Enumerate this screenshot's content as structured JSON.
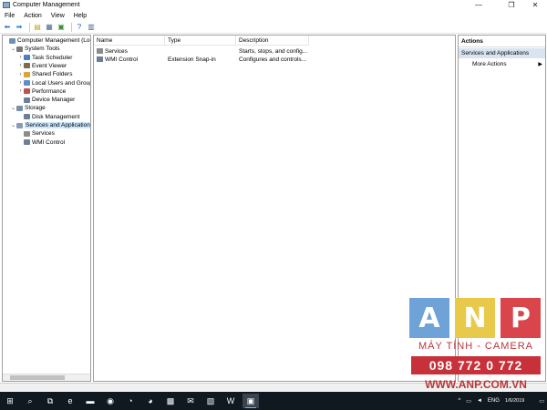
{
  "window": {
    "title": "Computer Management",
    "controls": [
      "—",
      "❐",
      "✕"
    ]
  },
  "menu": [
    "File",
    "Action",
    "View",
    "Help"
  ],
  "toolbar": {
    "buttons": [
      {
        "icon": "back-arrow-icon",
        "glyph": "⬅",
        "color": "#2a7bd4"
      },
      {
        "icon": "forward-arrow-icon",
        "glyph": "➡",
        "color": "#2a7bd4"
      },
      {
        "icon": "folder-up-icon",
        "glyph": "▤",
        "color": "#c79a2a"
      },
      {
        "icon": "show-hide-tree-icon",
        "glyph": "▦",
        "color": "#4a6a92"
      },
      {
        "icon": "export-list-icon",
        "glyph": "▣",
        "color": "#3d8b3d"
      },
      {
        "icon": "help-icon",
        "glyph": "?",
        "color": "#1f57b5"
      },
      {
        "icon": "properties-icon",
        "glyph": "▥",
        "color": "#4a6a92"
      }
    ]
  },
  "tree": [
    {
      "label": "Computer Management (Local",
      "level": 0,
      "expander": "",
      "icon": "computer-icon",
      "color": "#6f8fb5"
    },
    {
      "label": "System Tools",
      "level": 1,
      "expander": "⌄",
      "icon": "tools-icon",
      "color": "#7a7a7a"
    },
    {
      "label": "Task Scheduler",
      "level": 2,
      "expander": "›",
      "icon": "clock-icon",
      "color": "#4a7fc0"
    },
    {
      "label": "Event Viewer",
      "level": 2,
      "expander": "›",
      "icon": "event-viewer-icon",
      "color": "#7d6a4f"
    },
    {
      "label": "Shared Folders",
      "level": 2,
      "expander": "›",
      "icon": "shared-folder-icon",
      "color": "#d9a63a"
    },
    {
      "label": "Local Users and Groups",
      "level": 2,
      "expander": "›",
      "icon": "users-icon",
      "color": "#5c8cc9"
    },
    {
      "label": "Performance",
      "level": 2,
      "expander": "›",
      "icon": "performance-icon",
      "color": "#c0504d"
    },
    {
      "label": "Device Manager",
      "level": 2,
      "expander": "",
      "icon": "device-manager-icon",
      "color": "#6b7f99"
    },
    {
      "label": "Storage",
      "level": 1,
      "expander": "⌄",
      "icon": "storage-icon",
      "color": "#7a8ea8"
    },
    {
      "label": "Disk Management",
      "level": 2,
      "expander": "",
      "icon": "disk-icon",
      "color": "#6b7f99"
    },
    {
      "label": "Services and Applications",
      "level": 1,
      "expander": "⌄",
      "icon": "services-apps-icon",
      "color": "#8a9bb3",
      "selected": true
    },
    {
      "label": "Services",
      "level": 2,
      "expander": "",
      "icon": "gear-icon",
      "color": "#8c8c8c"
    },
    {
      "label": "WMI Control",
      "level": 2,
      "expander": "",
      "icon": "wmi-icon",
      "color": "#6b7f99"
    }
  ],
  "list": {
    "columns": [
      "Name",
      "Type",
      "Description"
    ],
    "rows": [
      {
        "name": "Services",
        "type": "",
        "description": "Starts, stops, and config...",
        "icon": "gear-icon",
        "color": "#8c8c8c"
      },
      {
        "name": "WMI Control",
        "type": "Extension Snap-in",
        "description": "Configures and controls...",
        "icon": "wmi-icon",
        "color": "#6b7f99"
      }
    ]
  },
  "actions": {
    "title": "Actions",
    "section": "Services and Applications",
    "items": [
      "More Actions"
    ]
  },
  "taskbar": {
    "items": [
      {
        "icon": "windows-start-icon",
        "glyph": "⊞"
      },
      {
        "icon": "search-icon",
        "glyph": "⌕"
      },
      {
        "icon": "task-view-icon",
        "glyph": "⧉"
      },
      {
        "icon": "edge-browser-icon",
        "glyph": "e"
      },
      {
        "icon": "file-explorer-icon",
        "glyph": "▬"
      },
      {
        "icon": "chrome-icon",
        "glyph": "◉"
      },
      {
        "icon": "firefox-icon",
        "glyph": "◔"
      },
      {
        "icon": "firefox-alt-icon",
        "glyph": "◕"
      },
      {
        "icon": "store-icon",
        "glyph": "▩"
      },
      {
        "icon": "mail-icon",
        "glyph": "✉"
      },
      {
        "icon": "notepad-icon",
        "glyph": "▧"
      },
      {
        "icon": "word-icon",
        "glyph": "W"
      },
      {
        "icon": "computer-management-icon",
        "glyph": "▣",
        "active": true
      }
    ],
    "tray": {
      "chevron": "^",
      "network": "▭",
      "volume": "◄",
      "language": "ENG",
      "time": "",
      "date": "1/6/2019",
      "notifications": "▭"
    }
  },
  "watermark": {
    "letters": [
      {
        "char": "A",
        "color": "#6fa3d8"
      },
      {
        "char": "N",
        "color": "#e8c94a"
      },
      {
        "char": "P",
        "color": "#d9454b"
      }
    ],
    "subtitle": "MÁY TÍNH - CAMERA",
    "phone": "098 772 0 772",
    "website": "WWW.ANP.COM.VN"
  }
}
